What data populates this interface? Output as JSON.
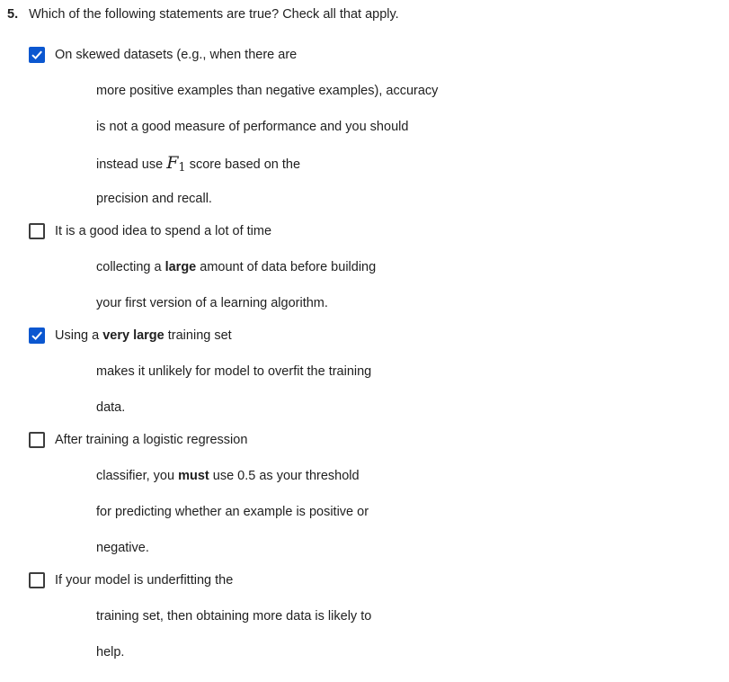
{
  "question": {
    "number": "5.",
    "prompt": "Which of the following statements are true? Check all that apply."
  },
  "colors": {
    "checkbox_checked": "#0b57d0",
    "checkmark": "#ffffff",
    "checkbox_border": "#3d3d3d"
  },
  "icons": {
    "checked": "checkmark-icon"
  },
  "options": [
    {
      "checked": true,
      "first_line": "On skewed datasets (e.g., when there are",
      "line2": "more positive examples than negative examples), accuracy",
      "line3": "is not a good measure of performance and you should",
      "line4_pre": "instead use ",
      "math_symbol": "F",
      "math_subscript": "1",
      "line4_post": " score based on the",
      "line5": "precision and recall."
    },
    {
      "checked": false,
      "first_line": "It is a good idea to spend a lot of time",
      "line2_pre": "collecting a ",
      "line2_bold": "large",
      "line2_post": " amount of data before building",
      "line3": "your first version of a learning algorithm."
    },
    {
      "checked": true,
      "first_line_pre": "Using a ",
      "first_line_bold": "very large",
      "first_line_post": " training set",
      "line2": "makes it unlikely for model to overfit the training",
      "line3": "data."
    },
    {
      "checked": false,
      "first_line": "After training a logistic regression",
      "line2_pre": "classifier, you ",
      "line2_bold": "must",
      "line2_post": " use 0.5 as your threshold",
      "line3": "for predicting whether an example is positive or",
      "line4": "negative."
    },
    {
      "checked": false,
      "first_line": "If your model is underfitting the",
      "line2": "training set, then obtaining more data is likely to",
      "line3": "help."
    }
  ]
}
